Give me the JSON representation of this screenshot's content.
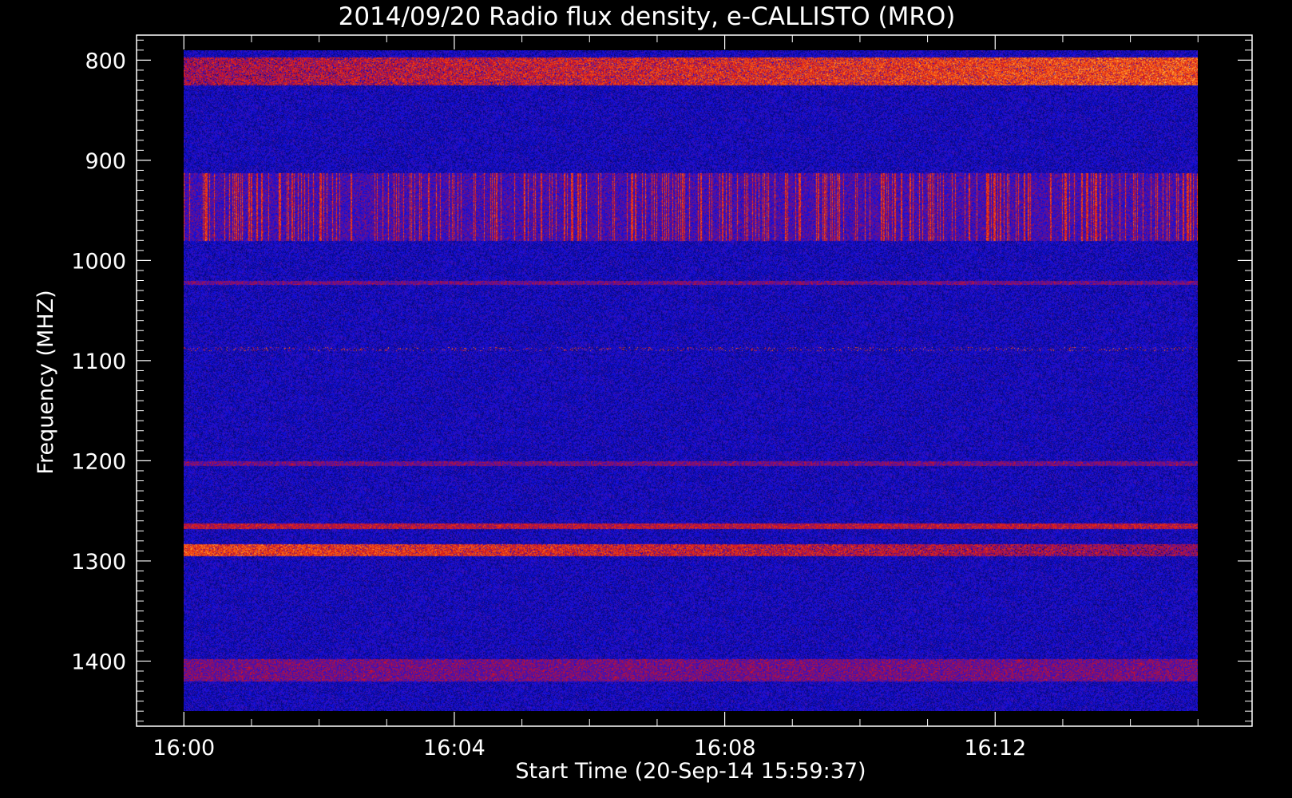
{
  "chart_data": {
    "type": "heatmap",
    "title": "2014/09/20  Radio flux density, e-CALLISTO (MRO)",
    "xlabel": "Start Time (20-Sep-14 15:59:37)",
    "ylabel": "Frequency (MHZ)",
    "x_ticks": [
      "16:00",
      "16:04",
      "16:08",
      "16:12"
    ],
    "x_tick_minutes": [
      0,
      4,
      8,
      12
    ],
    "x_range_minutes": [
      -0.7,
      15.8
    ],
    "y_ticks": [
      800,
      900,
      1000,
      1100,
      1200,
      1300,
      1400
    ],
    "y_range_mhz": [
      775,
      1465
    ],
    "data_extent": {
      "x_minutes": [
        0,
        15
      ],
      "y_mhz": [
        790,
        1450
      ]
    },
    "y_inverted": true,
    "colormap": [
      "#000000",
      "#1010e8",
      "#d01020",
      "#ff6a10",
      "#ffe060"
    ],
    "features": [
      {
        "freq_mhz": [
          797,
          825
        ],
        "intensity": "strong",
        "note": "persistent band, brightest late in interval"
      },
      {
        "freq_mhz": [
          912,
          980
        ],
        "intensity": "moderate",
        "note": "vertical red striations"
      },
      {
        "freq_mhz": [
          1020,
          1024
        ],
        "intensity": "weak"
      },
      {
        "freq_mhz": [
          1086,
          1090
        ],
        "intensity": "weak",
        "note": "dotted line"
      },
      {
        "freq_mhz": [
          1200,
          1205
        ],
        "intensity": "weak"
      },
      {
        "freq_mhz": [
          1262,
          1268
        ],
        "intensity": "moderate"
      },
      {
        "freq_mhz": [
          1283,
          1295
        ],
        "intensity": "strong",
        "note": "bright yellow early segment"
      },
      {
        "freq_mhz": [
          1398,
          1420
        ],
        "intensity": "weak"
      }
    ]
  }
}
